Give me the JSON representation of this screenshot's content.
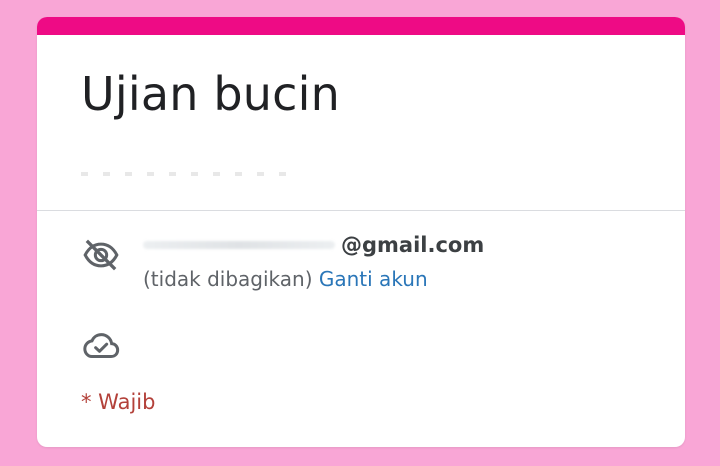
{
  "form": {
    "title": "Ujian bucin",
    "account": {
      "email_visible": "@gmail.com",
      "not_shared": "(tidak dibagikan)",
      "switch_account": "Ganti akun"
    },
    "required_note": "* Wajib"
  },
  "icons": {
    "privacy": "eye-off-icon",
    "cloud": "cloud-done-icon"
  },
  "colors": {
    "background": "#f9a6d6",
    "accent": "#ee0b85",
    "link": "#2a76b8",
    "required": "#b3413a"
  }
}
